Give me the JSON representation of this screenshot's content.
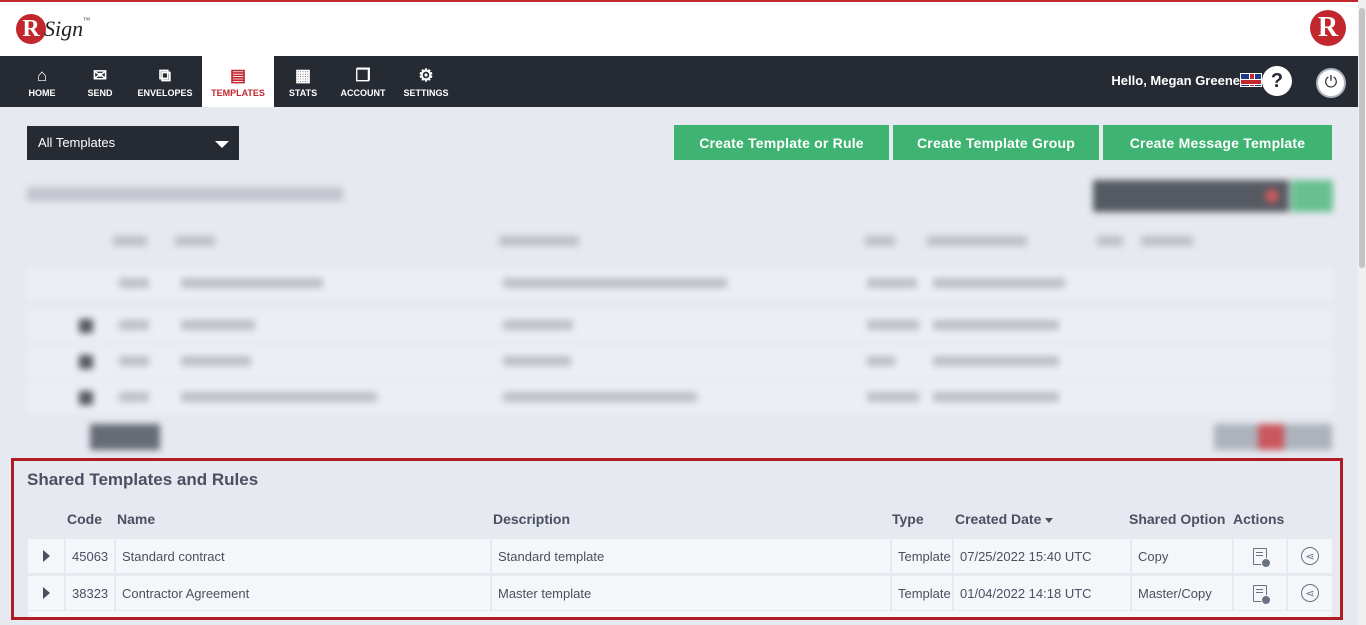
{
  "brand": {
    "logo_letter": "R",
    "logo_text": "Sign",
    "logo_tm": "™",
    "right_logo_letter": "R"
  },
  "nav": {
    "items": [
      {
        "label": "HOME",
        "icon": "⌂"
      },
      {
        "label": "SEND",
        "icon": "✉"
      },
      {
        "label": "ENVELOPES",
        "icon": "⧉"
      },
      {
        "label": "TEMPLATES",
        "icon": "▤"
      },
      {
        "label": "STATS",
        "icon": "▦"
      },
      {
        "label": "ACCOUNT",
        "icon": "❐"
      },
      {
        "label": "SETTINGS",
        "icon": "⚙"
      }
    ],
    "active": "TEMPLATES",
    "greeting": "Hello, Megan Greene",
    "help_label": "?",
    "power_label": "⏻"
  },
  "toolbar": {
    "filter_value": "All Templates",
    "create_template_label": "Create Template or Rule",
    "create_group_label": "Create Template Group",
    "create_message_label": "Create Message Template"
  },
  "shared": {
    "title": "Shared Templates and Rules",
    "columns": {
      "code": "Code",
      "name": "Name",
      "description": "Description",
      "type": "Type",
      "created": "Created Date",
      "shared_option": "Shared Option",
      "actions": "Actions"
    },
    "rows": [
      {
        "code": "45063",
        "name": "Standard contract",
        "description": "Standard template",
        "type": "Template",
        "created": "07/25/2022 15:40 UTC",
        "shared_option": "Copy"
      },
      {
        "code": "38323",
        "name": "Contractor Agreement",
        "description": "Master template",
        "type": "Template",
        "created": "01/04/2022 14:18 UTC",
        "shared_option": "Master/Copy"
      }
    ]
  },
  "colors": {
    "brand_red": "#c1272d",
    "nav_dark": "#262b33",
    "action_green": "#3fb371",
    "highlight_border": "#b01c23"
  }
}
